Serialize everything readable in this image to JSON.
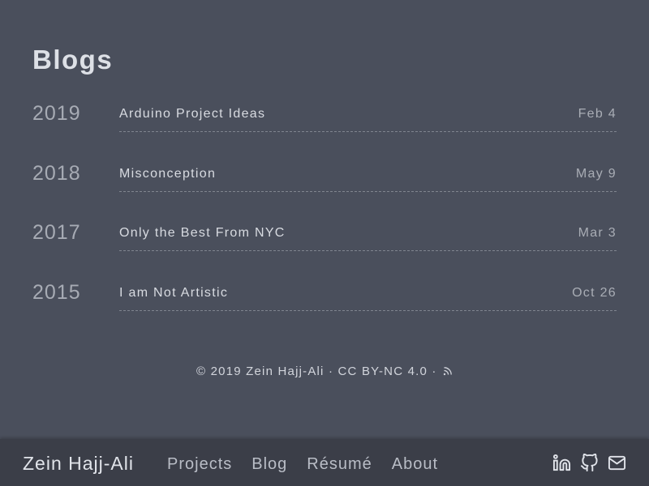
{
  "page": {
    "title": "Blogs"
  },
  "posts": [
    {
      "year": "2019",
      "title": "Arduino Project Ideas",
      "date": "Feb 4"
    },
    {
      "year": "2018",
      "title": "Misconception",
      "date": "May 9"
    },
    {
      "year": "2017",
      "title": "Only the Best From NYC",
      "date": "Mar 3"
    },
    {
      "year": "2015",
      "title": "I am Not Artistic",
      "date": "Oct 26"
    }
  ],
  "footer": {
    "copyright": "© 2019 Zein Hajj-Ali · CC BY-NC 4.0 ·",
    "rss_icon": "rss-icon"
  },
  "navbar": {
    "brand": "Zein Hajj-Ali",
    "links": [
      "Projects",
      "Blog",
      "Résumé",
      "About"
    ],
    "social_icons": [
      "linkedin-icon",
      "github-icon",
      "mail-icon"
    ]
  },
  "colors": {
    "background": "#4a4f5c",
    "navbar_background": "#3b3e48",
    "text": "#d4d7de",
    "muted_text": "#a7abb4",
    "divider": "#80858f"
  }
}
